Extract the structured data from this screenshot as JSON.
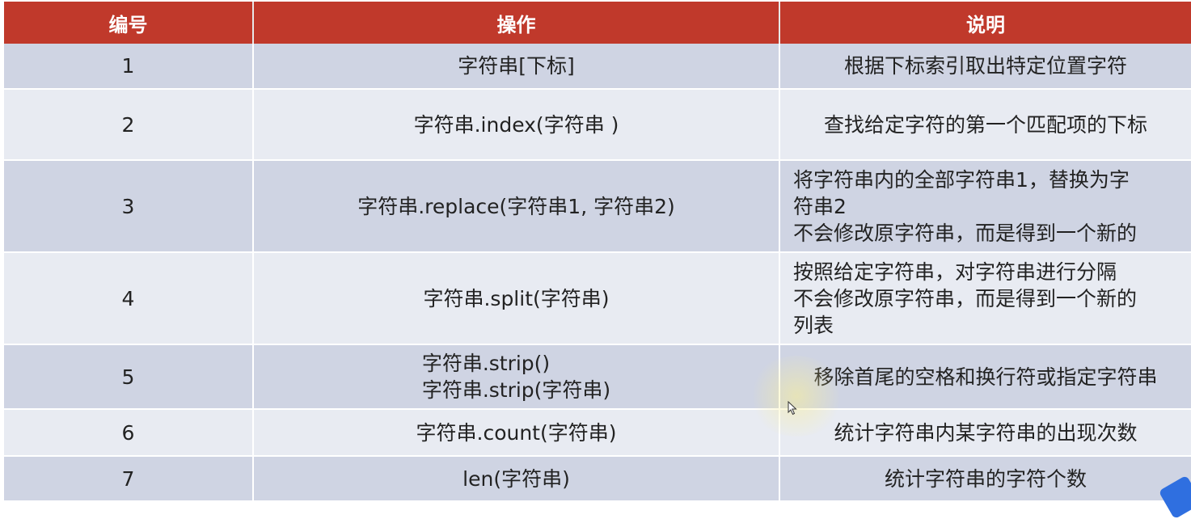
{
  "table": {
    "headers": [
      "编号",
      "操作",
      "说明"
    ],
    "rows": [
      {
        "num": "1",
        "op": [
          "字符串[下标]"
        ],
        "desc": [
          "根据下标索引取出特定位置字符"
        ]
      },
      {
        "num": "2",
        "op": [
          "字符串.index(字符串 )"
        ],
        "desc": [
          "查找给定字符的第一个匹配项的下标"
        ]
      },
      {
        "num": "3",
        "op": [
          "字符串.replace(字符串1, 字符串2)"
        ],
        "desc": [
          "将字符串内的全部字符串1，替换为字",
          "符串2",
          "不会修改原字符串，而是得到一个新的"
        ]
      },
      {
        "num": "4",
        "op": [
          "字符串.split(字符串)"
        ],
        "desc": [
          "按照给定字符串，对字符串进行分隔",
          "不会修改原字符串，而是得到一个新的",
          "列表"
        ]
      },
      {
        "num": "5",
        "op": [
          "字符串.strip()",
          "字符串.strip(字符串)"
        ],
        "desc": [
          "移除首尾的空格和换行符或指定字符串"
        ]
      },
      {
        "num": "6",
        "op": [
          "字符串.count(字符串)"
        ],
        "desc": [
          "统计字符串内某字符串的出现次数"
        ]
      },
      {
        "num": "7",
        "op": [
          "len(字符串)"
        ],
        "desc": [
          "统计字符串的字符个数"
        ]
      }
    ]
  },
  "colors": {
    "header_bg": "#c0392b",
    "row_odd": "#cfd4e3",
    "row_even": "#e8ebf2"
  },
  "icons": {
    "cursor": "mouse-pointer-icon"
  }
}
